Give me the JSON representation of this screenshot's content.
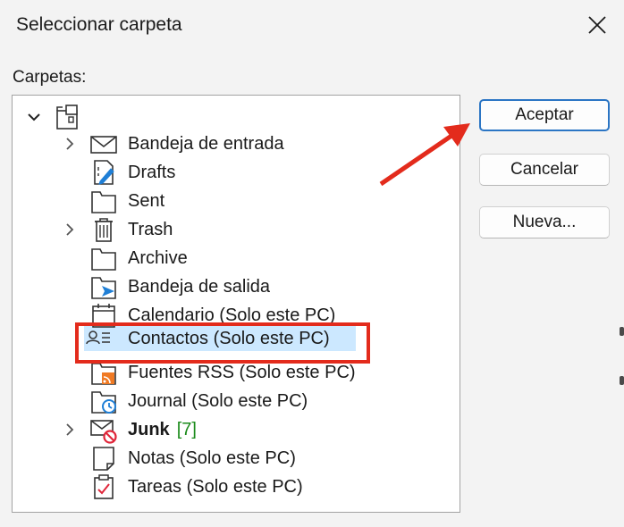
{
  "dialog": {
    "title": "Seleccionar carpeta",
    "folders_label": "Carpetas:"
  },
  "tree": {
    "items": [
      {
        "label": "",
        "icon": "root-folders-icon",
        "expanded": true
      },
      {
        "label": "Bandeja de entrada",
        "icon": "envelope-icon",
        "collapsed_arrow": true
      },
      {
        "label": "Drafts",
        "icon": "drafts-icon"
      },
      {
        "label": "Sent",
        "icon": "folder-icon"
      },
      {
        "label": "Trash",
        "icon": "trash-icon",
        "collapsed_arrow": true
      },
      {
        "label": "Archive",
        "icon": "folder-icon"
      },
      {
        "label": "Bandeja de salida",
        "icon": "outbox-icon"
      },
      {
        "label": "Calendario (Solo este PC)",
        "icon": "calendar-icon"
      },
      {
        "label": "Contactos (Solo este PC)",
        "icon": "contacts-icon",
        "selected": true
      },
      {
        "label": "Fuentes RSS (Solo este PC)",
        "icon": "rss-icon"
      },
      {
        "label": "Journal (Solo este PC)",
        "icon": "journal-icon"
      },
      {
        "label": "Junk",
        "icon": "junk-icon",
        "collapsed_arrow": true,
        "bold": true,
        "count": "[7]"
      },
      {
        "label": "Notas (Solo este PC)",
        "icon": "notes-icon"
      },
      {
        "label": "Tareas (Solo este PC)",
        "icon": "tasks-icon"
      }
    ]
  },
  "buttons": {
    "accept": "Aceptar",
    "cancel": "Cancelar",
    "new": "Nueva..."
  },
  "colors": {
    "selection": "#cce8ff",
    "annotation_red": "#e32b1c",
    "primary_border": "#2b75c4",
    "count_green": "#1a8a1a"
  }
}
